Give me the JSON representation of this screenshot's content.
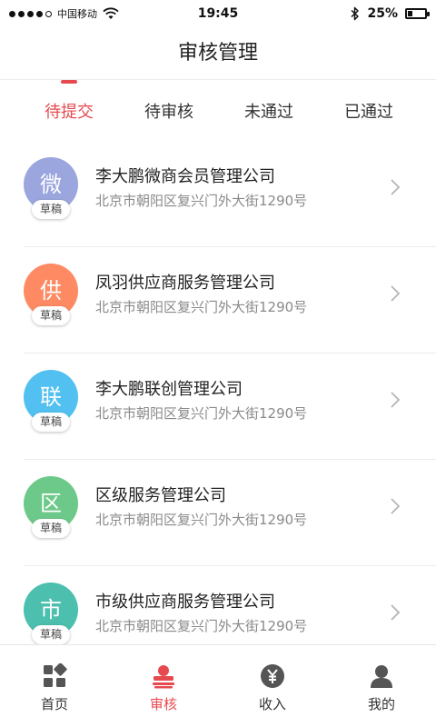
{
  "status_bar": {
    "carrier": "中国移动",
    "time": "19:45",
    "battery_text": "25%",
    "battery_level": 0.25
  },
  "header": {
    "title": "审核管理"
  },
  "tabs": [
    {
      "label": "待提交",
      "active": true
    },
    {
      "label": "待审核",
      "active": false
    },
    {
      "label": "未通过",
      "active": false
    },
    {
      "label": "已通过",
      "active": false
    }
  ],
  "items": [
    {
      "initial": "微",
      "name": "李大鹏微商会员管理公司",
      "address": "北京市朝阳区复兴门外大街1290号",
      "badge": "草稿",
      "color": "#9aa6dd"
    },
    {
      "initial": "供",
      "name": "凤羽供应商服务管理公司",
      "address": "北京市朝阳区复兴门外大街1290号",
      "badge": "草稿",
      "color": "#fd8a63"
    },
    {
      "initial": "联",
      "name": "李大鹏联创管理公司",
      "address": "北京市朝阳区复兴门外大街1290号",
      "badge": "草稿",
      "color": "#52c0f0"
    },
    {
      "initial": "区",
      "name": "区级服务管理公司",
      "address": "北京市朝阳区复兴门外大街1290号",
      "badge": "草稿",
      "color": "#6dc98a"
    },
    {
      "initial": "市",
      "name": "市级供应商服务管理公司",
      "address": "北京市朝阳区复兴门外大街1290号",
      "badge": "草稿",
      "color": "#4cbfae"
    }
  ],
  "tabbar": [
    {
      "label": "首页",
      "icon": "home-grid-icon",
      "active": false
    },
    {
      "label": "审核",
      "icon": "review-stamp-icon",
      "active": true
    },
    {
      "label": "收入",
      "icon": "yen-coin-icon",
      "active": false
    },
    {
      "label": "我的",
      "icon": "user-icon",
      "active": false
    }
  ],
  "colors": {
    "accent": "#e64a4f",
    "inactive_icon": "#555555"
  }
}
